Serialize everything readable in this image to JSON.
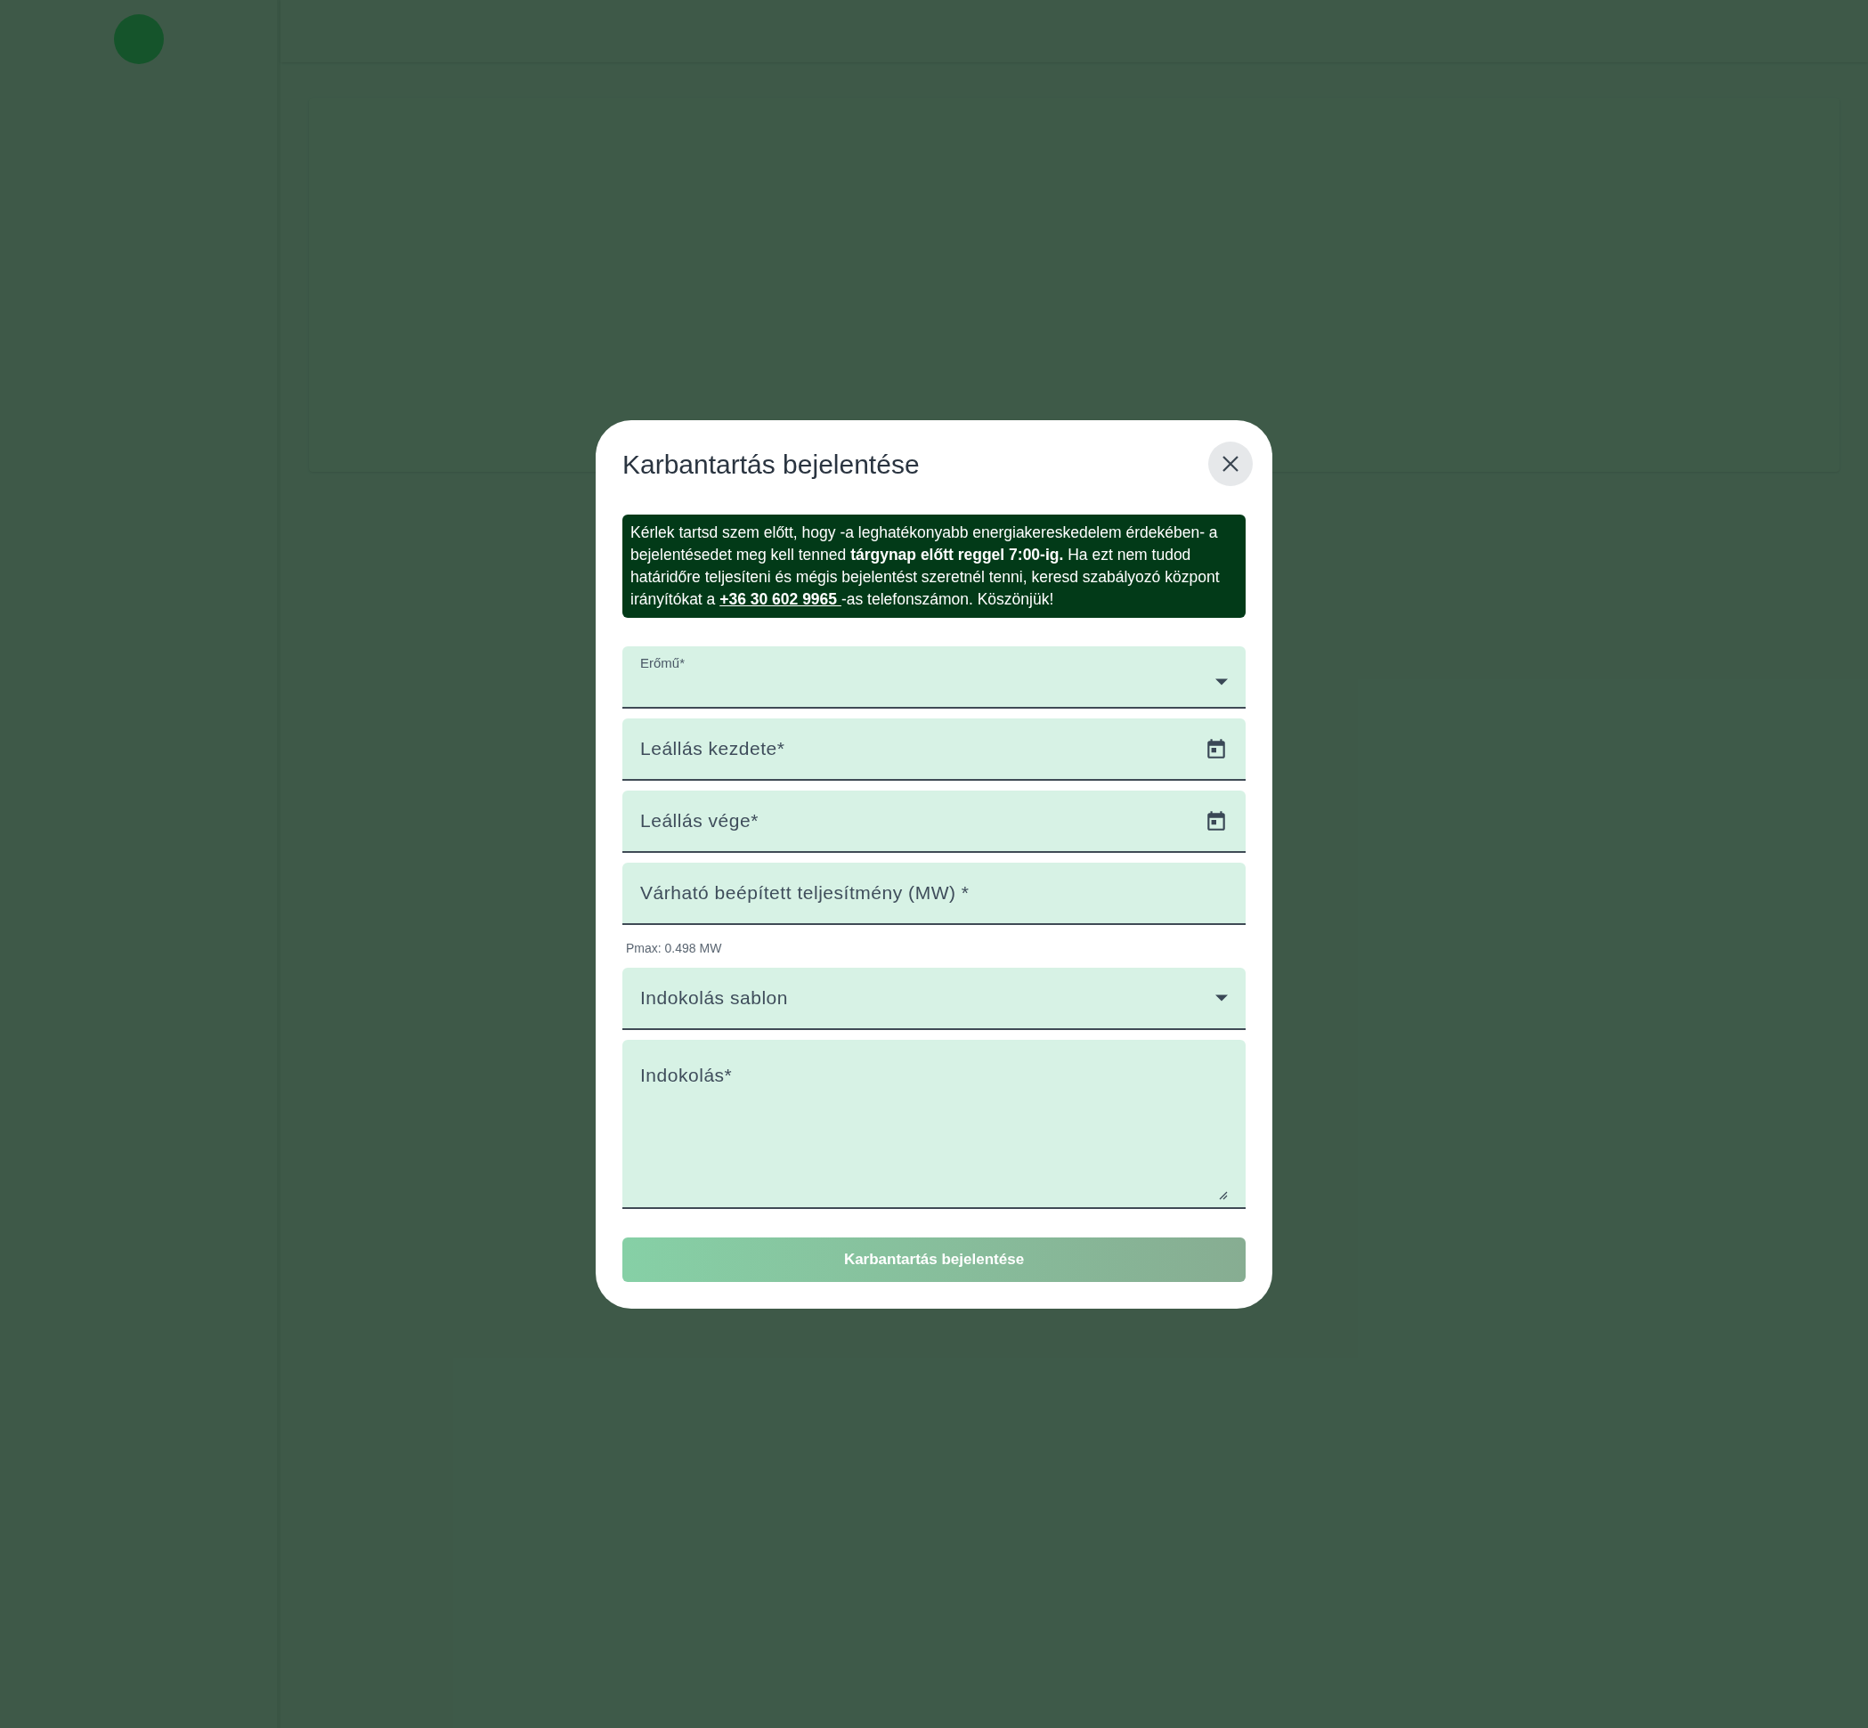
{
  "dialog": {
    "title": "Karbantartás bejelentése",
    "notice": {
      "text": "Kérlek tartsd szem előtt, hogy -a leghatékonyabb energiakereskedelem érdekében- a bejelentésedet meg kell tenned **tárgynap előtt reggel 7:00-ig.** Ha ezt nem tudod határidőre teljesíteni és mégis bejelentést szeretnél tenni, keresd szabályozó központ irányítókat a ",
      "link": "+36 30 602 9965 ",
      "text_after": "-as telefonszámon. Köszönjük!"
    },
    "fields": [
      {
        "kind": "select",
        "label": "Erőmű*",
        "floated": true
      },
      {
        "kind": "date",
        "label": "Leállás kezdete*",
        "floated": false
      },
      {
        "kind": "date",
        "label": "Leállás vége*",
        "floated": false
      },
      {
        "kind": "text",
        "label": "Várható beépített teljesítmény (MW) *",
        "floated": false,
        "helper": "Pmax: 0.498 MW"
      },
      {
        "kind": "select",
        "label": "Indokolás sablon",
        "floated": false
      },
      {
        "kind": "textarea",
        "label": "Indokolás*",
        "floated": false
      }
    ],
    "submit": {
      "label": "Karbantartás bejelentése",
      "disabled": true
    }
  }
}
